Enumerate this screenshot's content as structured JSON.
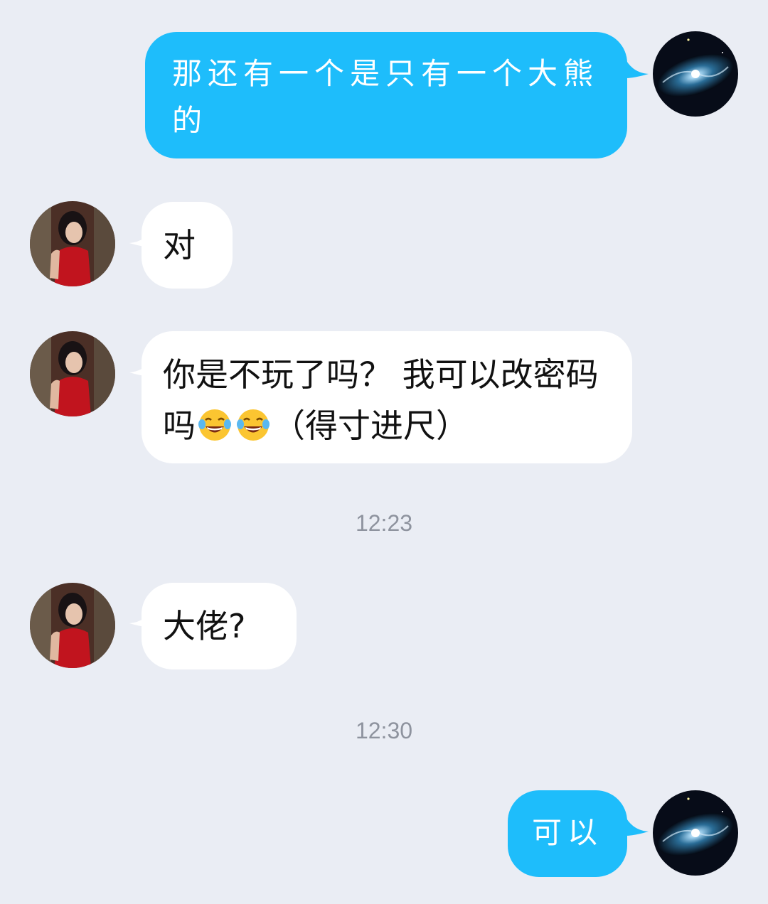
{
  "messages": [
    {
      "side": "out",
      "text": "那还有一个是只有一个大熊的",
      "avatar": "galaxy-avatar"
    },
    {
      "side": "in",
      "text": "对",
      "avatar": "girl-in-red-avatar"
    },
    {
      "side": "in",
      "text": "你是不玩了吗？ 我可以改密码吗",
      "text2": "（得寸进尺）",
      "emoji": "tears-of-joy-emoji",
      "avatar": "girl-in-red-avatar"
    },
    {
      "side": "in",
      "text": "大佬?",
      "avatar": "girl-in-red-avatar"
    },
    {
      "side": "out",
      "text": "可以",
      "avatar": "galaxy-avatar"
    }
  ],
  "timestamps": [
    "12:23",
    "12:30"
  ],
  "colors": {
    "background": "#eaedf4",
    "outgoing_bubble": "#1ebdfb",
    "incoming_bubble": "#ffffff",
    "timestamp": "#8e939e"
  }
}
